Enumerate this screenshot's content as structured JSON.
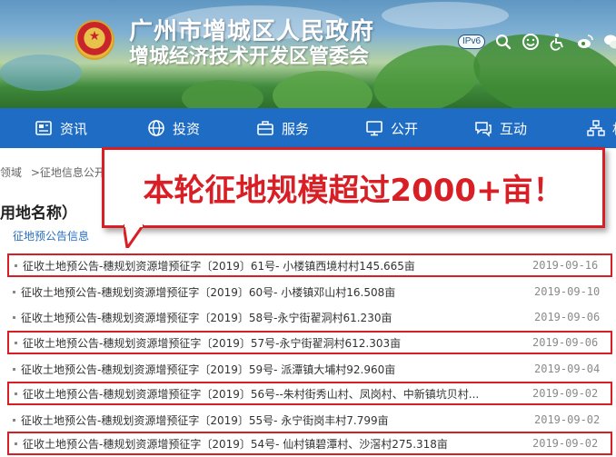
{
  "header": {
    "title": "广州市增城区人民政府",
    "subtitle": "增城经济技术开发区管委会",
    "ipv6_label": "IPv6",
    "tool_icons": [
      "search-icon",
      "smile-icon",
      "accessibility-icon",
      "weibo-icon",
      "wechat-icon"
    ]
  },
  "nav": {
    "items": [
      {
        "label": "资讯",
        "icon": "news-icon"
      },
      {
        "label": "投资",
        "icon": "globe-icon"
      },
      {
        "label": "服务",
        "icon": "briefcase-icon"
      },
      {
        "label": "公开",
        "icon": "monitor-icon"
      },
      {
        "label": "互动",
        "icon": "chat-icon"
      },
      {
        "label": "机",
        "icon": "org-icon"
      }
    ]
  },
  "breadcrumb": {
    "items": [
      "领域",
      ">征地信息公开"
    ]
  },
  "section": {
    "title": "用地名称）",
    "tab": "征地预公告信息"
  },
  "callout": {
    "text": "本轮征地规模超过2000+亩！"
  },
  "notices": [
    {
      "title": "征收土地预公告-穗规划资源增预征字〔2019〕61号- 小楼镇西境村村145.665亩",
      "date": "2019-09-16",
      "highlight": true
    },
    {
      "title": "征收土地预公告-穗规划资源增预征字〔2019〕60号- 小楼镇邓山村16.508亩",
      "date": "2019-09-10",
      "highlight": false
    },
    {
      "title": "征收土地预公告-穗规划资源增预征字〔2019〕58号-永宁街翟洞村61.230亩",
      "date": "2019-09-06",
      "highlight": false
    },
    {
      "title": "征收土地预公告-穗规划资源增预征字〔2019〕57号-永宁街翟洞村612.303亩",
      "date": "2019-09-06",
      "highlight": true
    },
    {
      "title": "征收土地预公告-穗规划资源增预征字〔2019〕59号- 派潭镇大埔村92.960亩",
      "date": "2019-09-04",
      "highlight": false
    },
    {
      "title": "征收土地预公告-穗规划资源增预征字〔2019〕56号--朱村街秀山村、凤岗村、中新镇坑贝村...",
      "date": "2019-09-02",
      "highlight": true
    },
    {
      "title": "征收土地预公告-穗规划资源增预征字〔2019〕55号- 永宁街岗丰村7.799亩",
      "date": "2019-09-02",
      "highlight": false
    },
    {
      "title": "征收土地预公告-穗规划资源增预征字〔2019〕54号- 仙村镇碧潭村、沙滘村275.318亩",
      "date": "2019-09-02",
      "highlight": true
    }
  ],
  "colors": {
    "nav_bg": "#1e6cc4",
    "highlight_red": "#d91f26",
    "link_blue": "#2a6fbf"
  }
}
